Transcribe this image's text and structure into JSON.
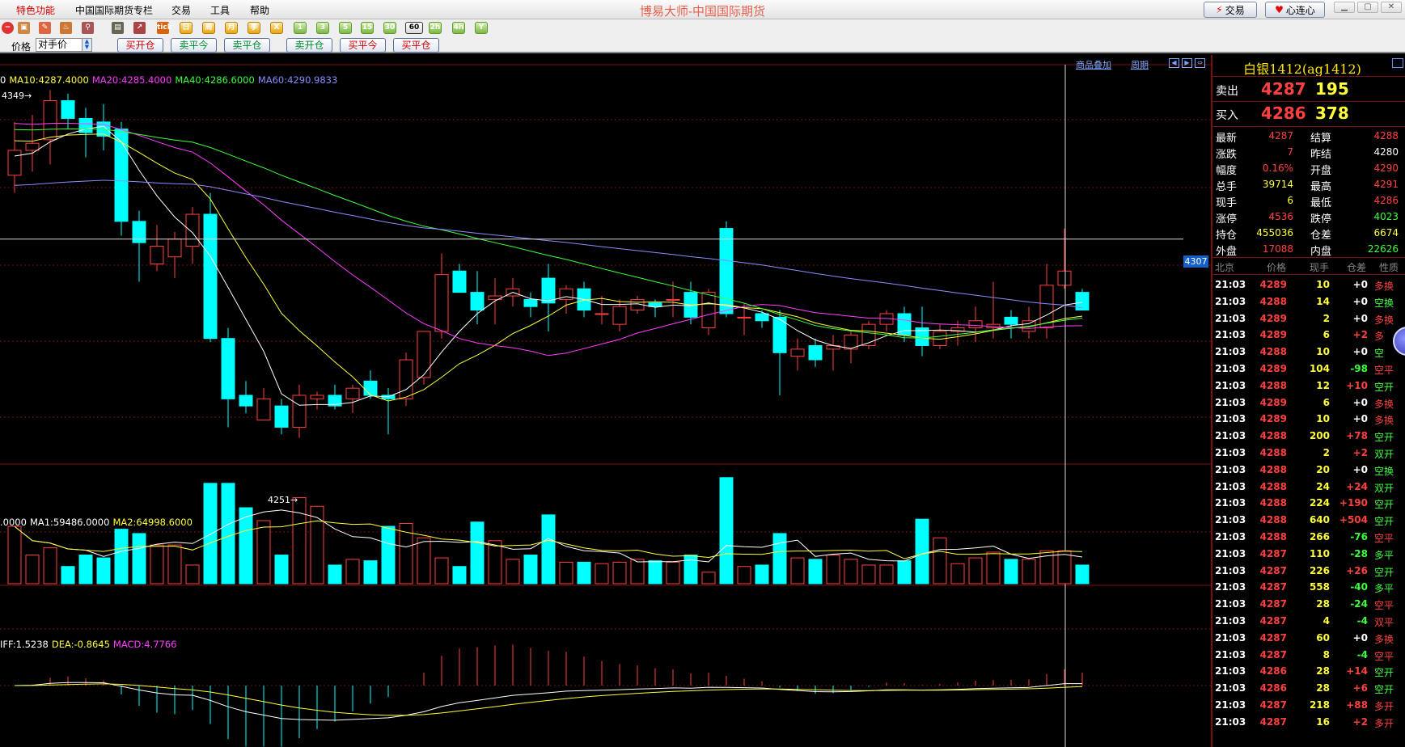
{
  "app": {
    "title": "博易大师-中国国际期货"
  },
  "menu": [
    {
      "label": "特色功能",
      "active": true
    },
    {
      "label": "中国国际期货专栏",
      "active": false
    },
    {
      "label": "交易",
      "active": false
    },
    {
      "label": "工具",
      "active": false
    },
    {
      "label": "帮助",
      "active": false
    }
  ],
  "title_buttons": {
    "trade": "交易",
    "xinlian": "心连心"
  },
  "toolbar": {
    "periods": [
      "tick",
      "日",
      "周",
      "月",
      "季",
      "X",
      "1",
      "3",
      "5",
      "15",
      "30",
      "60",
      "2h",
      "4h",
      "Y"
    ],
    "selected_period": "60"
  },
  "order": {
    "price_label": "价格",
    "price_mode": "对手价",
    "buttons_group1": [
      {
        "label": "买开仓",
        "color": "red"
      },
      {
        "label": "卖平今",
        "color": "green"
      },
      {
        "label": "卖平仓",
        "color": "green"
      }
    ],
    "buttons_group2": [
      {
        "label": "卖开仓",
        "color": "green"
      },
      {
        "label": "买平今",
        "color": "red"
      },
      {
        "label": "买平仓",
        "color": "red"
      }
    ]
  },
  "chart": {
    "ma_legend": [
      {
        "text": "0",
        "color": "#ffffff"
      },
      {
        "text": "MA10:4287.4000",
        "color": "#ffff3a"
      },
      {
        "text": "MA20:4285.4000",
        "color": "#ff3cff"
      },
      {
        "text": "MA40:4286.6000",
        "color": "#3cff3c"
      },
      {
        "text": "MA60:4290.9833",
        "color": "#8c8cff"
      }
    ],
    "links": {
      "overlay": "商品叠加",
      "period": "周期"
    },
    "high_marker": "4349→",
    "low_marker": "4251→",
    "crosshair_price": "4307",
    "vol_legend": [
      {
        "text": ".0000",
        "color": "#ffffff"
      },
      {
        "text": "MA1:59486.0000",
        "color": "#ffffff"
      },
      {
        "text": "MA2:64998.6000",
        "color": "#ffff3a"
      }
    ],
    "macd_legend": [
      {
        "text": "IFF:1.5238",
        "color": "#ffffff"
      },
      {
        "text": "DEA:-0.8645",
        "color": "#ffff3a"
      },
      {
        "text": "MACD:4.7766",
        "color": "#ff3cff"
      }
    ],
    "colors": {
      "up": "#ff4040",
      "down": "#00ffff",
      "grid": "#7a1010"
    }
  },
  "chart_data": {
    "type": "candlestick",
    "ohlc": [
      [
        4325,
        4340,
        4320,
        4332
      ],
      [
        4332,
        4342,
        4326,
        4334
      ],
      [
        4335,
        4349,
        4328,
        4346
      ],
      [
        4346,
        4348,
        4338,
        4341
      ],
      [
        4341,
        4344,
        4330,
        4337
      ],
      [
        4340,
        4345,
        4332,
        4336
      ],
      [
        4338,
        4340,
        4308,
        4312
      ],
      [
        4312,
        4315,
        4295,
        4306
      ],
      [
        4300,
        4311,
        4298,
        4305
      ],
      [
        4302,
        4309,
        4296,
        4307
      ],
      [
        4305,
        4316,
        4300,
        4314
      ],
      [
        4314,
        4320,
        4278,
        4279
      ],
      [
        4279,
        4282,
        4254,
        4262
      ],
      [
        4263,
        4267,
        4258,
        4260
      ],
      [
        4256,
        4265,
        4256,
        4262
      ],
      [
        4260,
        4262,
        4252,
        4254
      ],
      [
        4254,
        4266,
        4251,
        4263
      ],
      [
        4262,
        4264,
        4259,
        4263
      ],
      [
        4263,
        4266,
        4259,
        4260
      ],
      [
        4262,
        4266,
        4258,
        4265
      ],
      [
        4267,
        4270,
        4262,
        4263
      ],
      [
        4263,
        4265,
        4252,
        4262
      ],
      [
        4262,
        4275,
        4260,
        4273
      ],
      [
        4268,
        4281,
        4266,
        4281
      ],
      [
        4281,
        4303,
        4279,
        4297
      ],
      [
        4298,
        4300,
        4294,
        4292
      ],
      [
        4292,
        4298,
        4283,
        4287
      ],
      [
        4290,
        4296,
        4283,
        4291
      ],
      [
        4291,
        4296,
        4288,
        4293
      ],
      [
        4290,
        4292,
        4285,
        4288
      ],
      [
        4296,
        4300,
        4281,
        4289
      ],
      [
        4290,
        4294,
        4286,
        4293
      ],
      [
        4293,
        4295,
        4285,
        4287
      ],
      [
        4286,
        4291,
        4283,
        4286
      ],
      [
        4283,
        4290,
        4281,
        4288
      ],
      [
        4287,
        4291,
        4286,
        4290
      ],
      [
        4289,
        4290,
        4285,
        4288
      ],
      [
        4290,
        4295,
        4285,
        4290
      ],
      [
        4292,
        4295,
        4283,
        4285
      ],
      [
        4282,
        4293,
        4280,
        4292
      ],
      [
        4310,
        4312,
        4285,
        4286
      ],
      [
        4285,
        4289,
        4280,
        4285
      ],
      [
        4286,
        4287,
        4282,
        4284
      ],
      [
        4285,
        4287,
        4263,
        4275
      ],
      [
        4274,
        4279,
        4270,
        4276
      ],
      [
        4277,
        4279,
        4271,
        4273
      ],
      [
        4276,
        4280,
        4270,
        4277
      ],
      [
        4276,
        4281,
        4272,
        4280
      ],
      [
        4277,
        4284,
        4276,
        4283
      ],
      [
        4283,
        4287,
        4281,
        4286
      ],
      [
        4286,
        4288,
        4278,
        4280
      ],
      [
        4282,
        4288,
        4274,
        4277
      ],
      [
        4277,
        4283,
        4276,
        4281
      ],
      [
        4281,
        4284,
        4277,
        4282
      ],
      [
        4282,
        4288,
        4278,
        4284
      ],
      [
        4282,
        4295,
        4279,
        4283
      ],
      [
        4285,
        4287,
        4279,
        4283
      ],
      [
        4281,
        4288,
        4279,
        4284
      ],
      [
        4282,
        4300,
        4279,
        4294
      ],
      [
        4294,
        4310,
        4293,
        4298
      ],
      [
        4292,
        4293,
        4288,
        4287
      ]
    ],
    "volume_scale_note": "relative",
    "volume": [
      40,
      20,
      25,
      12,
      20,
      18,
      38,
      35,
      27,
      27,
      13,
      70,
      70,
      53,
      44,
      20,
      60,
      54,
      13,
      17,
      16,
      40,
      42,
      32,
      18,
      12,
      43,
      30,
      17,
      20,
      48,
      15,
      15,
      14,
      15,
      17,
      16,
      15,
      20,
      8,
      74,
      12,
      13,
      35,
      18,
      17,
      20,
      17,
      13,
      13,
      16,
      45,
      32,
      14,
      18,
      22,
      17,
      17,
      23,
      23,
      13
    ],
    "ylim": [
      4245,
      4355
    ]
  },
  "panel": {
    "contract": "白银1412(ag1412)",
    "ask": {
      "label": "卖出",
      "price": "4287",
      "vol": "195"
    },
    "bid": {
      "label": "买入",
      "price": "4286",
      "vol": "378"
    },
    "stats_left": [
      {
        "label": "最新",
        "value": "4287",
        "color": "#ff4040"
      },
      {
        "label": "涨跌",
        "value": "7",
        "color": "#ff4040"
      },
      {
        "label": "幅度",
        "value": "0.16%",
        "color": "#ff4040"
      },
      {
        "label": "总手",
        "value": "39714",
        "color": "#ffff3a"
      },
      {
        "label": "现手",
        "value": "6",
        "color": "#ffff3a"
      },
      {
        "label": "涨停",
        "value": "4536",
        "color": "#ff4040"
      },
      {
        "label": "持仓",
        "value": "455036",
        "color": "#ffff3a"
      },
      {
        "label": "外盘",
        "value": "17088",
        "color": "#ff4040"
      }
    ],
    "stats_right": [
      {
        "label": "结算",
        "value": "4288",
        "color": "#ff4040"
      },
      {
        "label": "昨结",
        "value": "4280",
        "color": "#ffffff"
      },
      {
        "label": "开盘",
        "value": "4290",
        "color": "#ff4040"
      },
      {
        "label": "最高",
        "value": "4291",
        "color": "#ff4040"
      },
      {
        "label": "最低",
        "value": "4286",
        "color": "#ff4040"
      },
      {
        "label": "跌停",
        "value": "4023",
        "color": "#3cff3c"
      },
      {
        "label": "仓差",
        "value": "6674",
        "color": "#ffff3a"
      },
      {
        "label": "内盘",
        "value": "22626",
        "color": "#3cff3c"
      }
    ],
    "tick_headers": {
      "time": "北京",
      "price": "价格",
      "vol": "现手",
      "oi": "仓差",
      "nature": "性质"
    },
    "ticks": [
      {
        "t": "21:03",
        "p": "4289",
        "v": "10",
        "oi": "+0",
        "n": "多换",
        "oc": "#ffffff",
        "nc": "#ff4040"
      },
      {
        "t": "21:03",
        "p": "4288",
        "v": "14",
        "oi": "+0",
        "n": "空换",
        "oc": "#ffffff",
        "nc": "#3cff3c"
      },
      {
        "t": "21:03",
        "p": "4289",
        "v": "2",
        "oi": "+0",
        "n": "多换",
        "oc": "#ffffff",
        "nc": "#ff4040"
      },
      {
        "t": "21:03",
        "p": "4289",
        "v": "6",
        "oi": "+2",
        "n": "多",
        "oc": "#ff4040",
        "nc": "#ff4040"
      },
      {
        "t": "21:03",
        "p": "4288",
        "v": "10",
        "oi": "+0",
        "n": "空",
        "oc": "#ffffff",
        "nc": "#3cff3c"
      },
      {
        "t": "21:03",
        "p": "4289",
        "v": "104",
        "oi": "-98",
        "n": "空平",
        "oc": "#3cff3c",
        "nc": "#ff4040"
      },
      {
        "t": "21:03",
        "p": "4288",
        "v": "12",
        "oi": "+10",
        "n": "空开",
        "oc": "#ff4040",
        "nc": "#3cff3c"
      },
      {
        "t": "21:03",
        "p": "4289",
        "v": "6",
        "oi": "+0",
        "n": "多换",
        "oc": "#ffffff",
        "nc": "#ff4040"
      },
      {
        "t": "21:03",
        "p": "4289",
        "v": "10",
        "oi": "+0",
        "n": "多换",
        "oc": "#ffffff",
        "nc": "#ff4040"
      },
      {
        "t": "21:03",
        "p": "4288",
        "v": "200",
        "oi": "+78",
        "n": "空开",
        "oc": "#ff4040",
        "nc": "#3cff3c"
      },
      {
        "t": "21:03",
        "p": "4288",
        "v": "2",
        "oi": "+2",
        "n": "双开",
        "oc": "#ff4040",
        "nc": "#3cff3c"
      },
      {
        "t": "21:03",
        "p": "4288",
        "v": "20",
        "oi": "+0",
        "n": "空换",
        "oc": "#ffffff",
        "nc": "#3cff3c"
      },
      {
        "t": "21:03",
        "p": "4288",
        "v": "24",
        "oi": "+24",
        "n": "双开",
        "oc": "#ff4040",
        "nc": "#3cff3c"
      },
      {
        "t": "21:03",
        "p": "4288",
        "v": "224",
        "oi": "+190",
        "n": "空开",
        "oc": "#ff4040",
        "nc": "#3cff3c"
      },
      {
        "t": "21:03",
        "p": "4288",
        "v": "640",
        "oi": "+504",
        "n": "空开",
        "oc": "#ff4040",
        "nc": "#3cff3c"
      },
      {
        "t": "21:03",
        "p": "4288",
        "v": "266",
        "oi": "-76",
        "n": "空平",
        "oc": "#3cff3c",
        "nc": "#ff4040"
      },
      {
        "t": "21:03",
        "p": "4287",
        "v": "110",
        "oi": "-28",
        "n": "多平",
        "oc": "#3cff3c",
        "nc": "#3cff3c"
      },
      {
        "t": "21:03",
        "p": "4287",
        "v": "226",
        "oi": "+26",
        "n": "空开",
        "oc": "#ff4040",
        "nc": "#3cff3c"
      },
      {
        "t": "21:03",
        "p": "4287",
        "v": "558",
        "oi": "-40",
        "n": "多平",
        "oc": "#3cff3c",
        "nc": "#3cff3c"
      },
      {
        "t": "21:03",
        "p": "4287",
        "v": "28",
        "oi": "-24",
        "n": "空平",
        "oc": "#3cff3c",
        "nc": "#ff4040"
      },
      {
        "t": "21:03",
        "p": "4287",
        "v": "4",
        "oi": "-4",
        "n": "双平",
        "oc": "#3cff3c",
        "nc": "#ff4040"
      },
      {
        "t": "21:03",
        "p": "4287",
        "v": "60",
        "oi": "+0",
        "n": "多换",
        "oc": "#ffffff",
        "nc": "#ff4040"
      },
      {
        "t": "21:03",
        "p": "4287",
        "v": "8",
        "oi": "-4",
        "n": "空平",
        "oc": "#3cff3c",
        "nc": "#ff4040"
      },
      {
        "t": "21:03",
        "p": "4286",
        "v": "28",
        "oi": "+14",
        "n": "空开",
        "oc": "#ff4040",
        "nc": "#3cff3c"
      },
      {
        "t": "21:03",
        "p": "4286",
        "v": "28",
        "oi": "+6",
        "n": "空开",
        "oc": "#ff4040",
        "nc": "#3cff3c"
      },
      {
        "t": "21:03",
        "p": "4287",
        "v": "218",
        "oi": "+88",
        "n": "多开",
        "oc": "#ff4040",
        "nc": "#ff4040"
      },
      {
        "t": "21:03",
        "p": "4287",
        "v": "16",
        "oi": "+2",
        "n": "多开",
        "oc": "#ff4040",
        "nc": "#ff4040"
      }
    ]
  }
}
